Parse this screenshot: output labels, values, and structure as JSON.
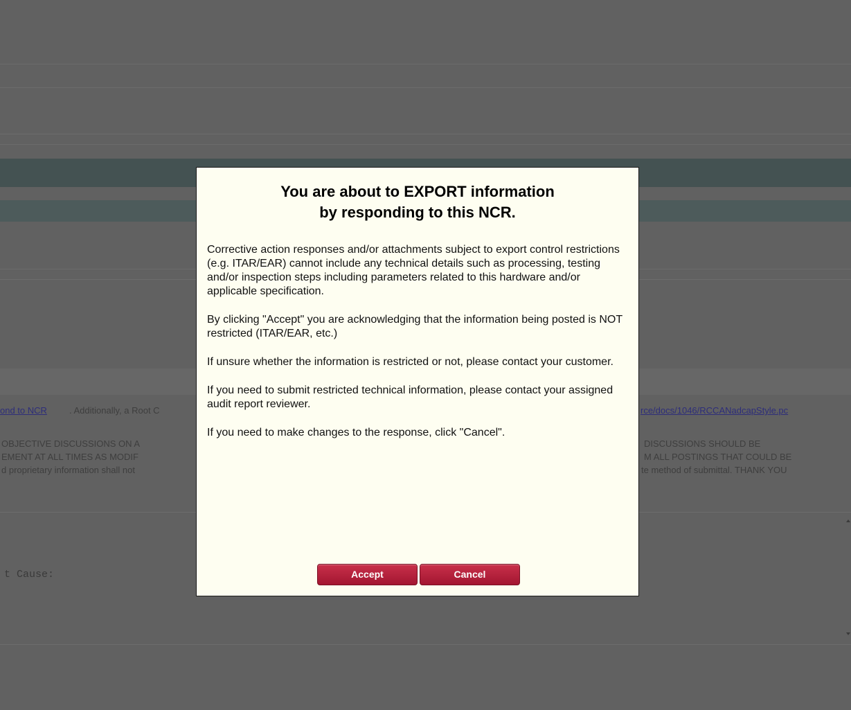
{
  "modal": {
    "title_line1": "You are about to EXPORT information",
    "title_line2": "by responding to this NCR.",
    "paragraphs": [
      "Corrective action responses and/or attachments subject to export control restrictions (e.g. ITAR/EAR) cannot include any technical details such as processing, testing and/or inspection steps including parameters related to this hardware and/or applicable specification.",
      "By clicking \"Accept\" you are acknowledging that the information being posted is NOT restricted (ITAR/EAR, etc.)",
      "If unsure whether the information is restricted or not, please contact your customer.",
      "If you need to submit restricted technical information, please contact your assigned audit report reviewer.",
      "If you need to make changes to the response, click \"Cancel\"."
    ],
    "accept_label": "Accept",
    "cancel_label": "Cancel"
  },
  "background": {
    "link_left": "ond to NCR",
    "text_left": ". Additionally, a Root C",
    "link_right": "rce/docs/1046/RCCANadcapStyle.pc",
    "warning_left_1": "OBJECTIVE DISCUSSIONS ON A",
    "warning_left_2": "EMENT AT ALL TIMES AS MODIF",
    "warning_left_3": "d proprietary information shall not",
    "warning_right_1": "DISCUSSIONS SHOULD BE",
    "warning_right_2": "M ALL POSTINGS THAT COULD BE",
    "warning_right_3": "te method of submittal. THANK YOU",
    "field_label": "t Cause:"
  },
  "colors": {
    "overlay": "#616161",
    "modal_bg": "#fefef1",
    "button": "#b01f39"
  }
}
